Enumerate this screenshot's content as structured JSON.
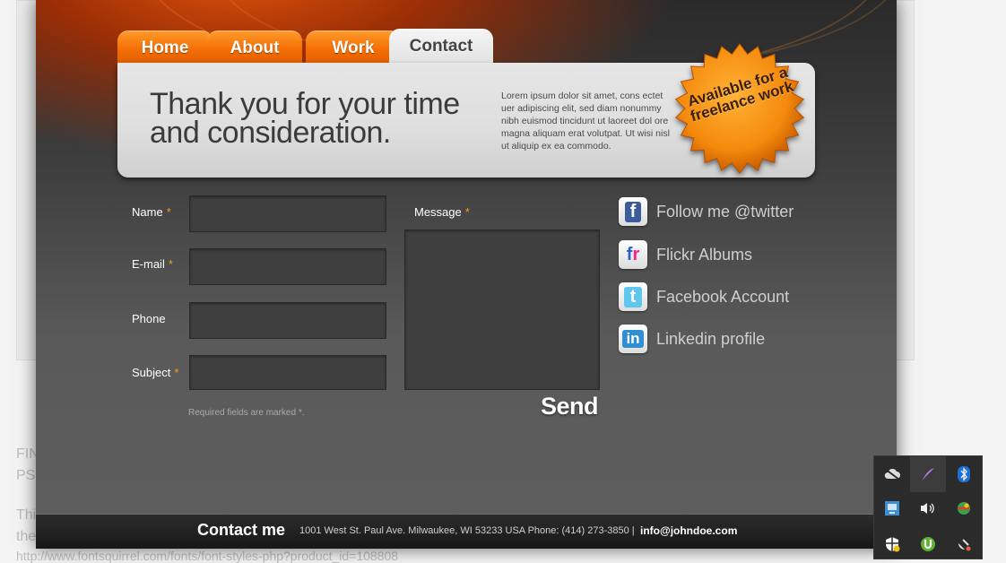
{
  "background_page": {
    "lines": [
      "FIN",
      "PS",
      "Thi",
      "the",
      "http://www.fontsquirrel.com/fonts/font-styles-php?product_id=108808"
    ]
  },
  "nav": {
    "tabs": [
      {
        "label": "Home"
      },
      {
        "label": "About"
      },
      {
        "label": "Work"
      },
      {
        "label": "Contact",
        "active": true
      }
    ]
  },
  "header": {
    "headline": "Thank you for your time and consideration.",
    "lorem": "Lorem ipsum dolor sit amet, cons ectet uer adipiscing elit, sed diam nonummy nibh euismod tincidunt ut laoreet dol ore magna aliquam erat volutpat. Ut wisi  nisl ut aliquip ex ea commodo.",
    "badge": "Available for a freelance work"
  },
  "form": {
    "name_label": "Name",
    "email_label": "E-mail",
    "phone_label": "Phone",
    "subject_label": "Subject",
    "message_label": "Message",
    "required_mark": "*",
    "hint": "Required fields are marked *.",
    "send_label": "Send"
  },
  "social": {
    "items": [
      {
        "label": "Follow me @twitter",
        "icon": "facebook-icon"
      },
      {
        "label": "Flickr Albums",
        "icon": "flickr-icon"
      },
      {
        "label": "Facebook Account",
        "icon": "twitter-icon"
      },
      {
        "label": "Linkedin profile",
        "icon": "linkedin-icon"
      }
    ]
  },
  "footer": {
    "title": "Contact me",
    "address": "1001 West St. Paul Ave. Milwaukee, WI  53233  USA Phone: (414) 273-3850 |",
    "email": "info@johndoe.com"
  },
  "tray": {
    "icons": [
      "cloud-off-icon",
      "feather-icon",
      "bluetooth-icon",
      "network-icon",
      "volume-icon",
      "globe-icon",
      "shield-warning-icon",
      "torrent-icon",
      "satellite-icon"
    ]
  },
  "colors": {
    "accent_orange": "#f56f05",
    "required": "#f19a20",
    "badge": "#f08a0e"
  }
}
